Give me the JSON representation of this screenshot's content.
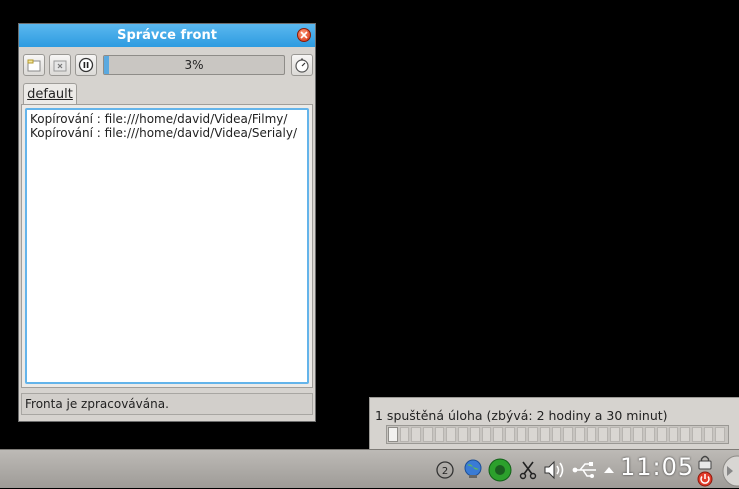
{
  "window": {
    "title": "Správce front",
    "progress_percent": 3,
    "progress_label": "3%",
    "tab_label": "default",
    "items": [
      "Kopírování : file:///home/david/Videa/Filmy/",
      "Kopírování : file:///home/david/Videa/Serialy/"
    ],
    "status_text": "Fronta je zpracovávána."
  },
  "job_popup": {
    "label": "1 spuštěná úloha (zbývá: 2 hodiny a 30 minut)",
    "progress_percent": 3
  },
  "taskbar": {
    "clock": "11:05",
    "tray_icons": [
      "klipper-icon",
      "network-globe-icon",
      "update-status-icon",
      "scissors-icon",
      "volume-icon",
      "usb-device-icon",
      "tray-expand-arrow-icon",
      "lock-icon",
      "power-icon",
      "logout-icon"
    ],
    "badge_number": "2"
  }
}
